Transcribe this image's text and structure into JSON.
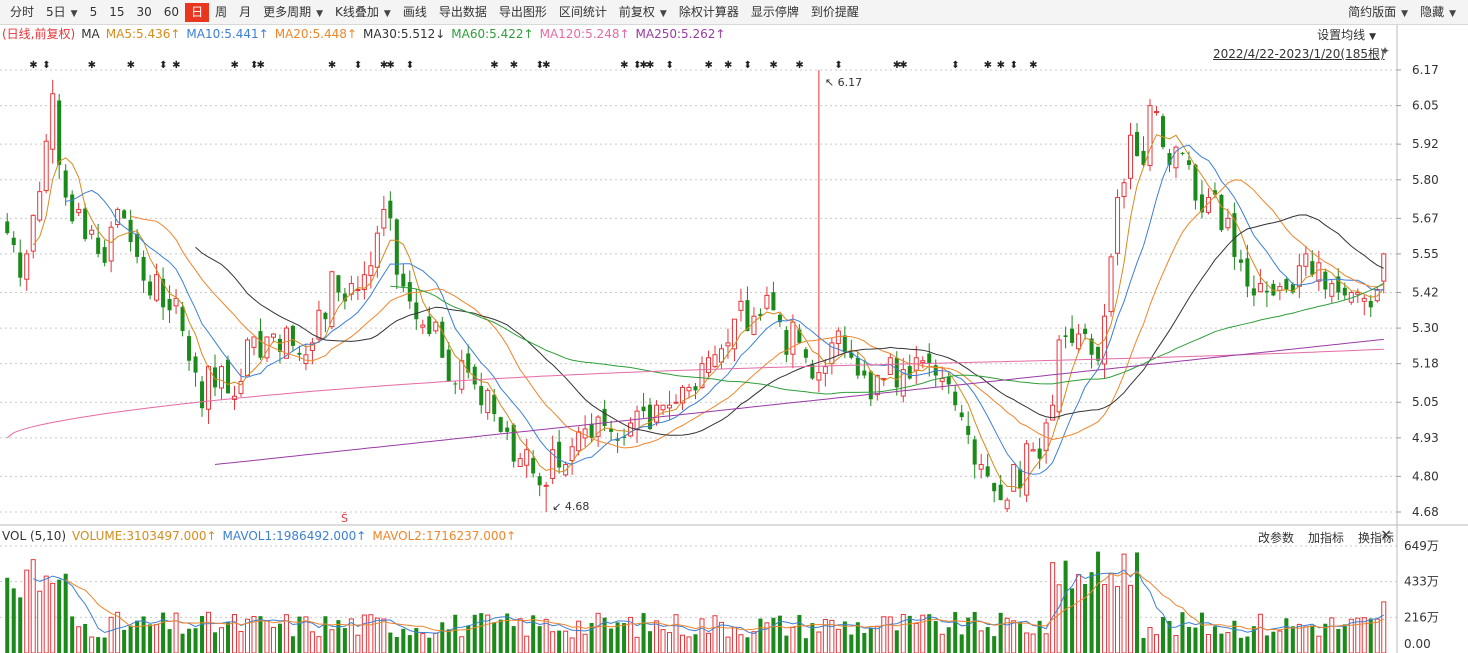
{
  "toolbar": {
    "items": [
      {
        "label": "分时"
      },
      {
        "label": "5日",
        "caret": true
      },
      {
        "label": "5"
      },
      {
        "label": "15"
      },
      {
        "label": "30"
      },
      {
        "label": "60"
      },
      {
        "label": "日",
        "active": true
      },
      {
        "label": "周"
      },
      {
        "label": "月"
      },
      {
        "label": "更多周期",
        "caret": true
      },
      {
        "label": "K线叠加",
        "caret": true
      },
      {
        "label": "画线"
      },
      {
        "label": "导出数据"
      },
      {
        "label": "导出图形"
      },
      {
        "label": "区间统计"
      },
      {
        "label": "前复权",
        "caret": true
      },
      {
        "label": "除权计算器"
      },
      {
        "label": "显示停牌"
      },
      {
        "label": "到价提醒"
      }
    ],
    "right": [
      {
        "label": "简约版面",
        "caret": true
      },
      {
        "label": "隐藏",
        "caret": true
      }
    ]
  },
  "ma_legend": {
    "prefix": "(日线,前复权)",
    "label": "MA",
    "items": [
      {
        "text": "MA5:5.436",
        "arrow": "↑",
        "color": "#d58b1e"
      },
      {
        "text": "MA10:5.441",
        "arrow": "↑",
        "color": "#3c7fd6"
      },
      {
        "text": "MA20:5.448",
        "arrow": "↑",
        "color": "#f0852c"
      },
      {
        "text": "MA30:5.512",
        "arrow": "↓",
        "color": "#333333"
      },
      {
        "text": "MA60:5.422",
        "arrow": "↑",
        "color": "#2f9e3a"
      },
      {
        "text": "MA120:5.248",
        "arrow": "↑",
        "color": "#e56aa5"
      },
      {
        "text": "MA250:5.262",
        "arrow": "↑",
        "color": "#9a3aa6"
      }
    ]
  },
  "set_ma_label": "设置均线",
  "range_label": "2022/4/22-2023/1/20(185根)",
  "pin_icon": "pin-icon",
  "vol_legend": {
    "prefix": "VOL (5,10)",
    "items": [
      {
        "text": "VOLUME:3103497.000",
        "arrow": "↑",
        "color": "#d58b1e"
      },
      {
        "text": "MAVOL1:1986492.000",
        "arrow": "↑",
        "color": "#3c7fd6"
      },
      {
        "text": "MAVOL2:1716237.000",
        "arrow": "↑",
        "color": "#f0852c"
      }
    ]
  },
  "vol_tools": [
    "改参数",
    "加指标",
    "换指标"
  ],
  "close_icon": "×",
  "colors": {
    "up": "#e8353a",
    "down": "#1b8a1b",
    "grid": "#c9c9c9",
    "axis_text": "#333333"
  },
  "chart_data": {
    "type": "candlestick",
    "title": "",
    "period": "日线",
    "adjustment": "前复权",
    "y_ticks": [
      6.17,
      6.05,
      5.92,
      5.8,
      5.67,
      5.55,
      5.42,
      5.3,
      5.18,
      5.05,
      4.93,
      4.8,
      4.68
    ],
    "ylim": [
      4.68,
      6.17
    ],
    "annotations": {
      "max": {
        "value": "6.17",
        "index": 125
      },
      "min": {
        "value": "4.68",
        "index": 83
      }
    },
    "closes": [
      5.62,
      5.58,
      5.47,
      5.55,
      5.68,
      5.76,
      5.93,
      6.09,
      5.85,
      5.74,
      5.66,
      5.7,
      5.6,
      5.63,
      5.55,
      5.52,
      5.64,
      5.7,
      5.67,
      5.59,
      5.54,
      5.46,
      5.41,
      5.48,
      5.37,
      5.36,
      5.4,
      5.29,
      5.19,
      5.15,
      5.03,
      5.17,
      5.1,
      5.17,
      5.08,
      5.07,
      5.12,
      5.26,
      5.27,
      5.2,
      5.27,
      5.28,
      5.22,
      5.3,
      5.24,
      5.21,
      5.21,
      5.25,
      5.36,
      5.33,
      5.49,
      5.42,
      5.39,
      5.45,
      5.43,
      5.48,
      5.51,
      5.62,
      5.7,
      5.67,
      5.48,
      5.44,
      5.39,
      5.33,
      5.31,
      5.28,
      5.32,
      5.2,
      5.12,
      5.11,
      5.19,
      5.15,
      5.11,
      5.04,
      5.09,
      5.01,
      4.95,
      4.95,
      4.85,
      4.86,
      4.89,
      4.81,
      4.77,
      4.77,
      4.89,
      4.83,
      4.84,
      4.9,
      4.95,
      4.96,
      4.93,
      5.0,
      4.97,
      4.95,
      4.92,
      4.93,
      4.98,
      5.02,
      5.02,
      4.96,
      5.04,
      5.04,
      5.04,
      5.05,
      5.1,
      5.1,
      5.09,
      5.18,
      5.2,
      5.21,
      5.23,
      5.25,
      5.33,
      5.39,
      5.29,
      5.34,
      5.34,
      5.41,
      5.36,
      5.32,
      5.21,
      5.32,
      5.25,
      5.2,
      5.13,
      5.15,
      5.17,
      5.25,
      5.29,
      5.22,
      5.2,
      5.14,
      5.14,
      5.06,
      5.14,
      5.13,
      5.2,
      5.1,
      5.16,
      5.13,
      5.2,
      5.19,
      5.18,
      5.14,
      5.13,
      5.11,
      5.04,
      5.0,
      4.94,
      4.84,
      4.84,
      4.8,
      4.75,
      4.72,
      4.72,
      4.84,
      4.76,
      4.91,
      4.89,
      4.86,
      4.98,
      5.04,
      5.26,
      5.27,
      5.25,
      5.28,
      5.28,
      5.21,
      5.19,
      5.34,
      5.54,
      5.74,
      5.79,
      5.95,
      5.88,
      5.85,
      6.05,
      6.03,
      5.91,
      5.85,
      5.91,
      5.89,
      5.85,
      5.73,
      5.69,
      5.74,
      5.75,
      5.63,
      5.67,
      5.54,
      5.52,
      5.44,
      5.41,
      5.45,
      5.42,
      5.41,
      5.44,
      5.43,
      5.42,
      5.51,
      5.55,
      5.48,
      5.52,
      5.43,
      5.45,
      5.42,
      5.41,
      5.42,
      5.42,
      5.4,
      5.37,
      5.43,
      5.55
    ],
    "ohlc_note": "Approximate daily bars read off the chart; opens/highs/lows are generated by the renderer from closes.",
    "ma_lines": [
      {
        "name": "MA5",
        "value": 5.436
      },
      {
        "name": "MA10",
        "value": 5.441
      },
      {
        "name": "MA20",
        "value": 5.448
      },
      {
        "name": "MA30",
        "value": 5.512
      },
      {
        "name": "MA60",
        "value": 5.422
      },
      {
        "name": "MA120",
        "value": 5.248
      },
      {
        "name": "MA250",
        "value": 5.262
      }
    ],
    "volume": {
      "y_ticks": [
        "649万",
        "433万",
        "216万",
        "0.00"
      ],
      "ylim": [
        0,
        649
      ],
      "unit": "万"
    },
    "star_markers": "row of ✱ and ⬍ glyph markers along the top of the price panel",
    "s_marker": "Ŝ"
  }
}
